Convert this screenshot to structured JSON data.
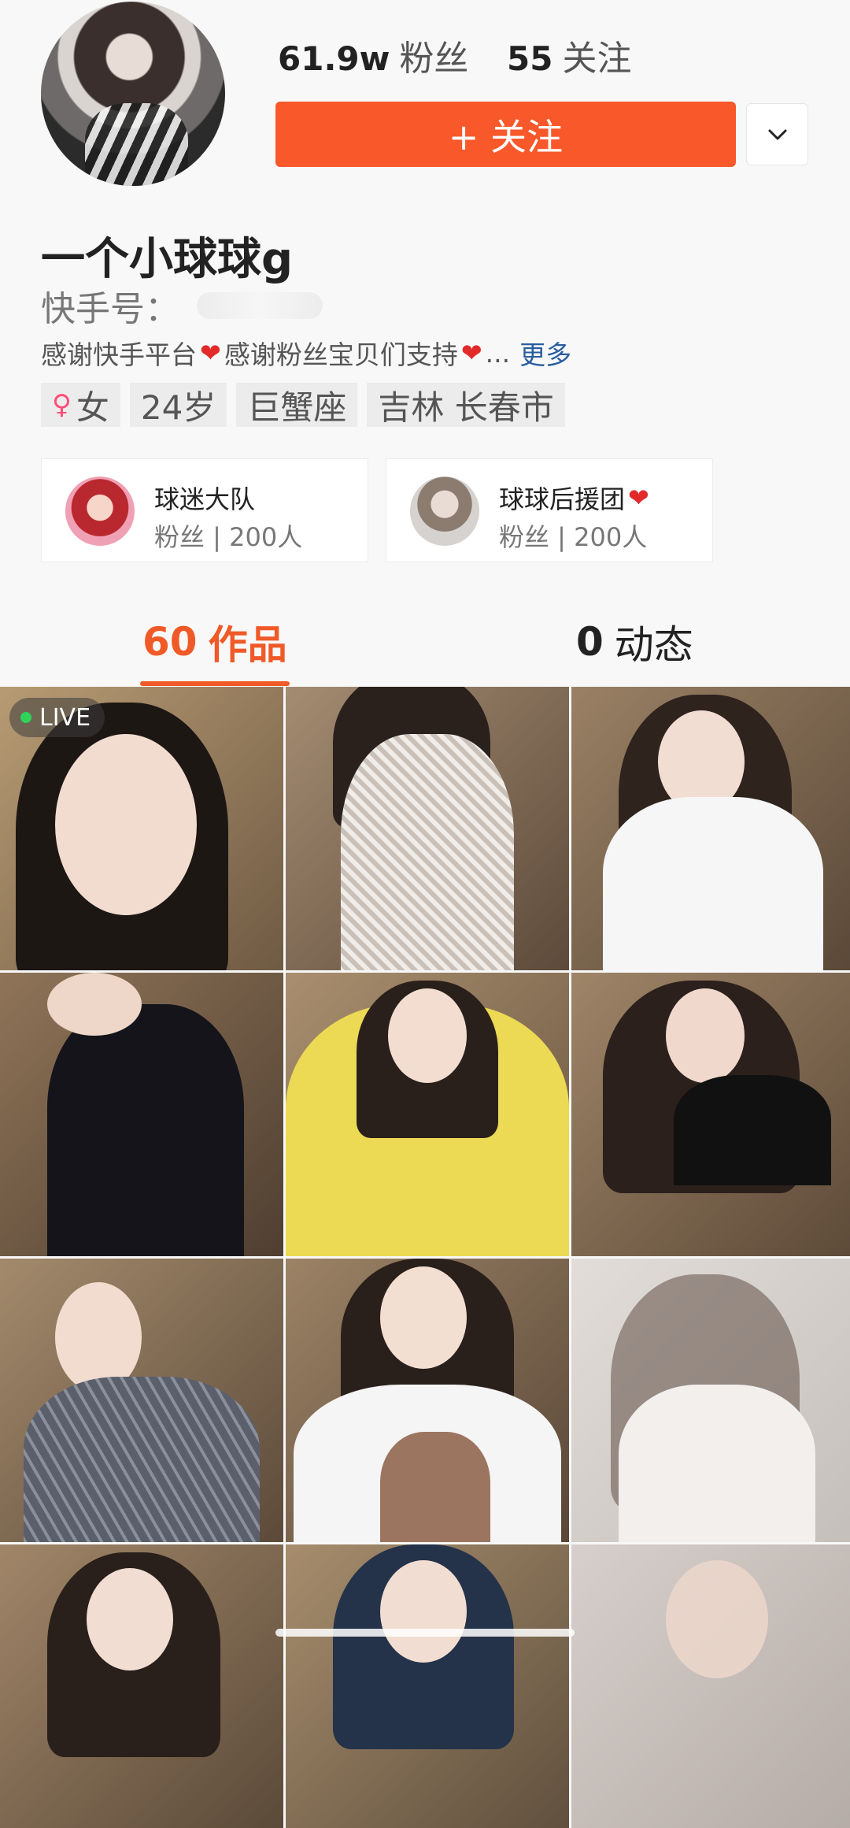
{
  "header": {
    "avatar": "profile-photo",
    "fans": {
      "count": "61.9w",
      "label": "粉丝"
    },
    "following": {
      "count": "55",
      "label": "关注"
    },
    "follow_button": {
      "icon": "plus-icon",
      "label": "+ 关注"
    },
    "more_button": {
      "icon": "chevron-down-icon"
    }
  },
  "profile": {
    "name": "一个小球球g",
    "id_label": "快手号：",
    "bio": {
      "part1": "感谢快手平台",
      "part2": "感谢粉丝宝贝们支持",
      "ellipsis": "...",
      "more": "更多"
    },
    "tags": {
      "gender": "女",
      "age": "24岁",
      "zodiac": "巨蟹座",
      "location": "吉林 长春市"
    }
  },
  "groups": [
    {
      "title": "球迷大队",
      "sub": "粉丝 | 200人"
    },
    {
      "title": "球球后援团",
      "sub": "粉丝 | 200人"
    }
  ],
  "tabs": {
    "works": {
      "count": "60",
      "label": "作品"
    },
    "moments": {
      "count": "0",
      "label": "动态"
    }
  },
  "grid": {
    "live_label": "LIVE",
    "tiles": [
      "video-1",
      "video-2",
      "video-3",
      "video-4",
      "video-5",
      "video-6",
      "video-7",
      "video-8",
      "video-9",
      "video-10",
      "video-11",
      "video-12"
    ]
  },
  "colors": {
    "accent": "#f8582a",
    "tab_active": "#f05a28",
    "link": "#2a5d9f",
    "heart": "#e22a2a",
    "live_dot": "#2fd35a"
  }
}
